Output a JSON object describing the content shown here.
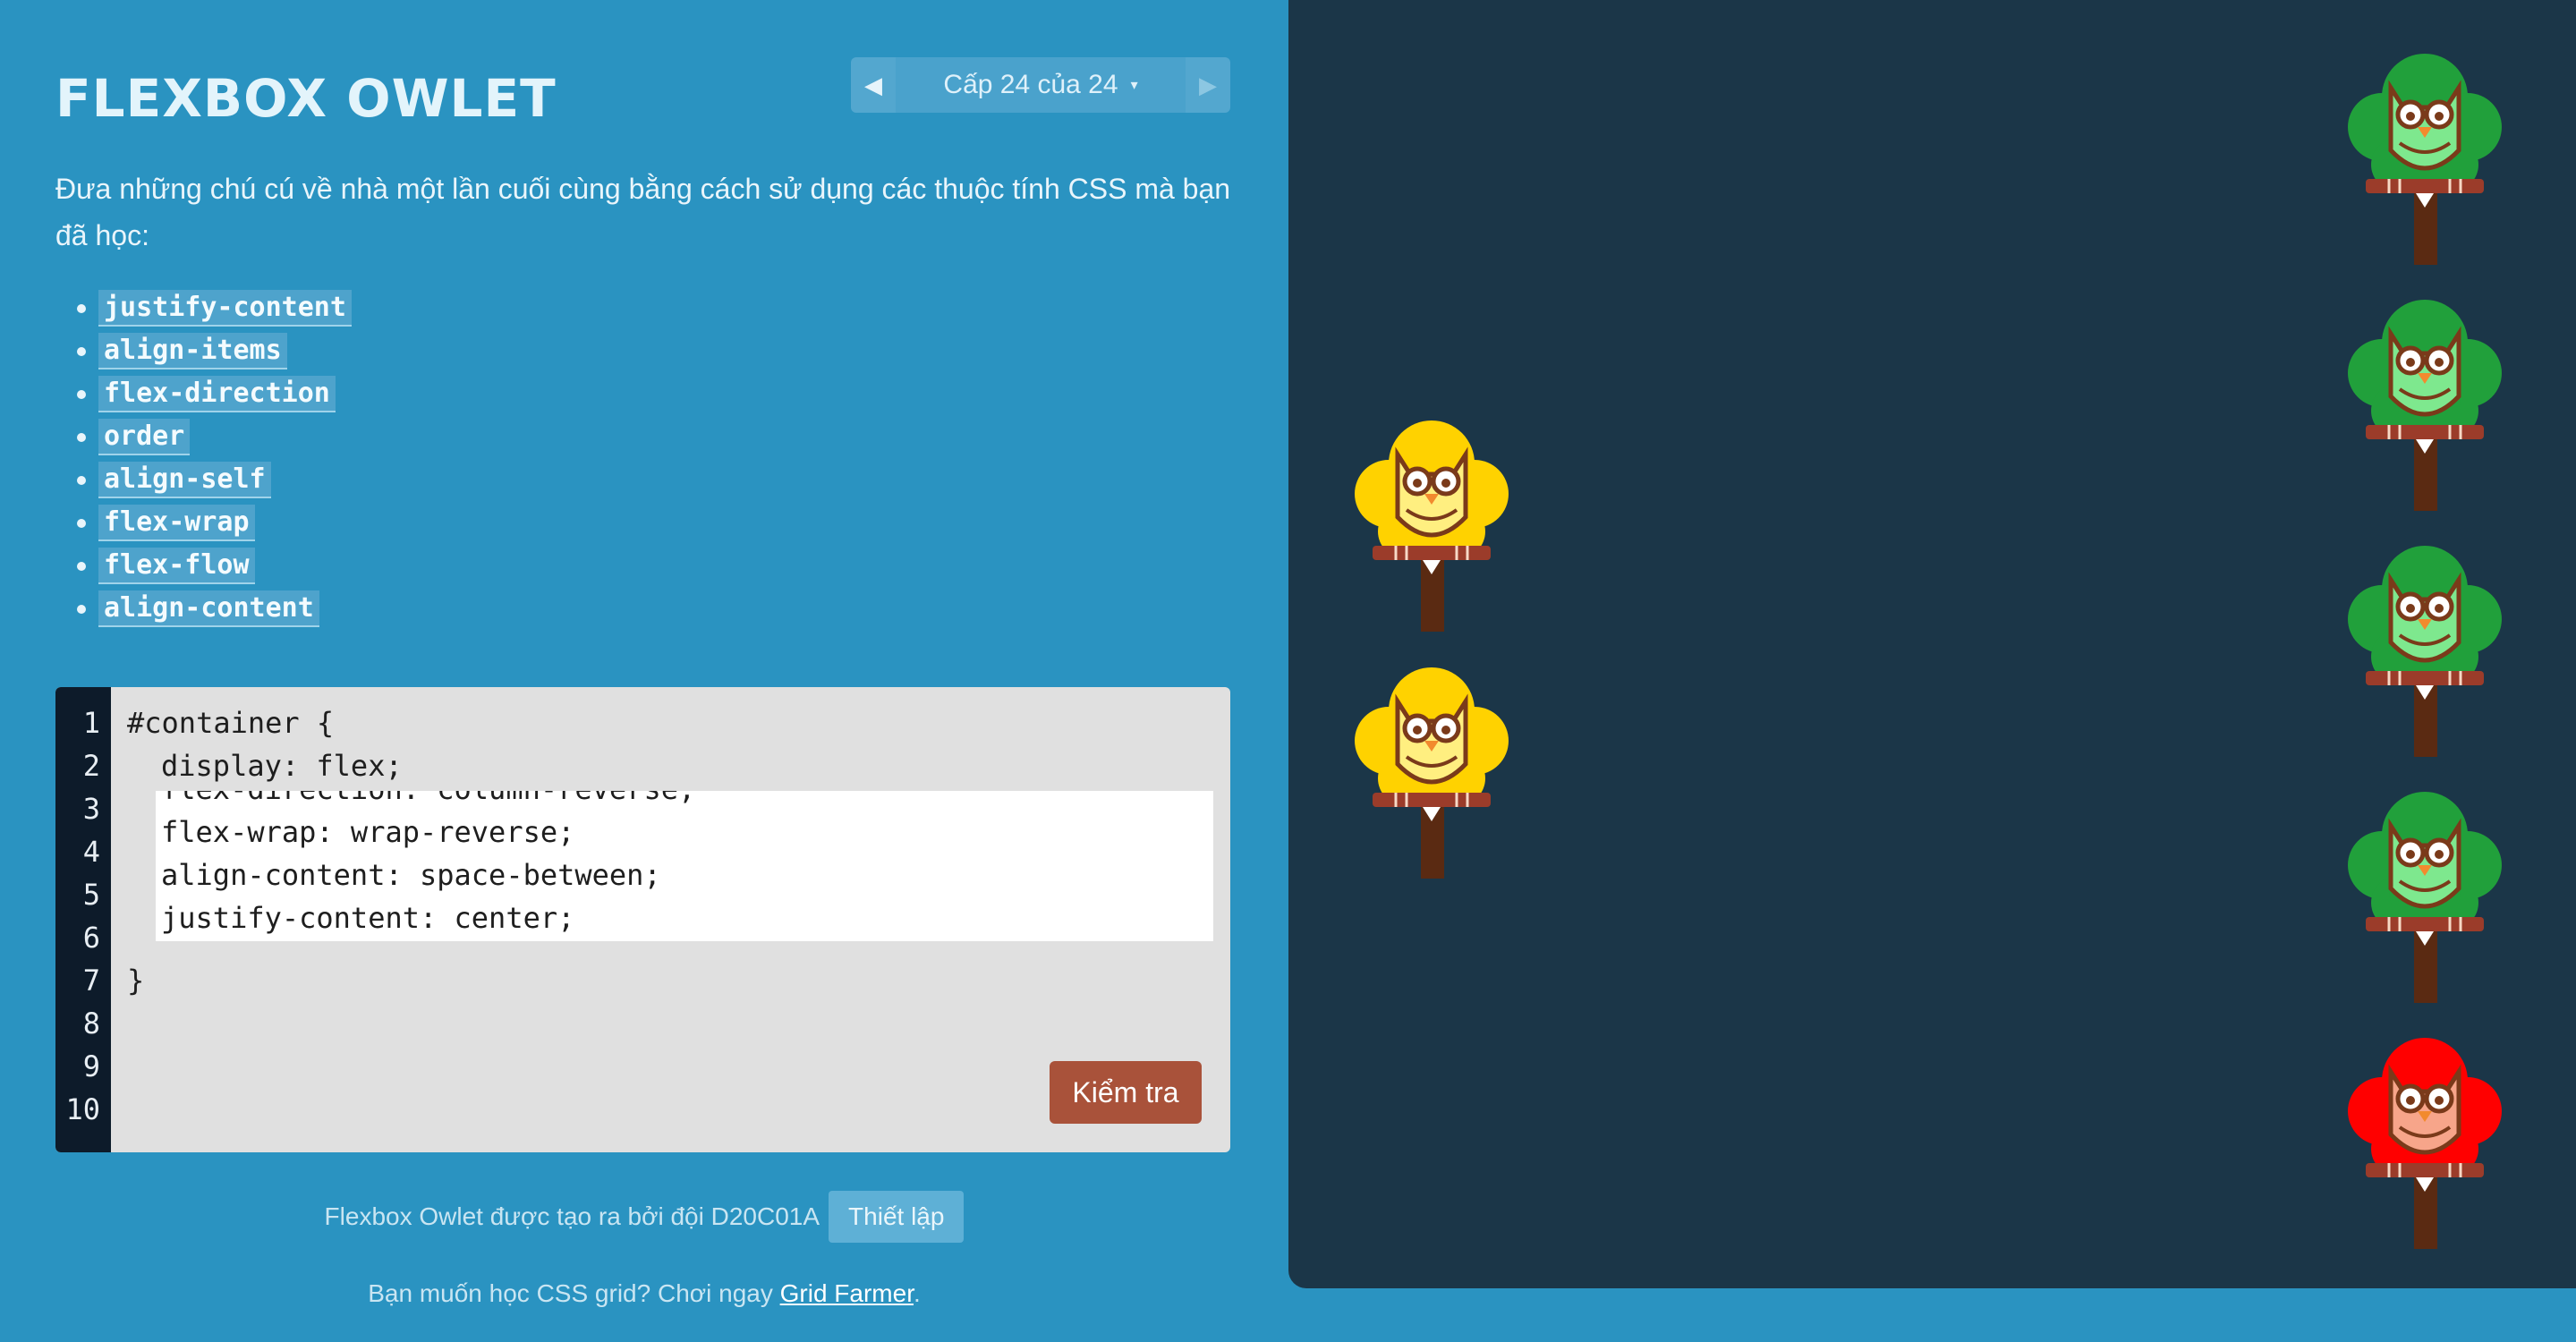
{
  "header": {
    "title": "FLEXBOX OWLET"
  },
  "level_nav": {
    "prev_icon": "triangle-left",
    "next_icon": "triangle-right",
    "label": "Cấp 24 của 24",
    "caret": "▾"
  },
  "instructions": "Đưa những chú cú về nhà một lần cuối cùng bằng cách sử dụng các thuộc tính CSS mà bạn đã học:",
  "properties": [
    "justify-content",
    "align-items",
    "flex-direction",
    "order",
    "align-self",
    "flex-wrap",
    "flex-flow",
    "align-content"
  ],
  "editor": {
    "line_numbers": [
      "1",
      "2",
      "3",
      "4",
      "5",
      "6",
      "7",
      "8",
      "9",
      "10"
    ],
    "line1": "#container {",
    "line2": "display: flex;",
    "input_lines": [
      "flex-direction: column-reverse;",
      "flex-wrap: wrap-reverse;",
      "align-content: space-between;",
      "justify-content: center;"
    ],
    "closing": "}",
    "check_label": "Kiểm tra"
  },
  "footer": {
    "credits": "Flexbox Owlet được tạo ra bởi đội D20C01A",
    "settings_label": "Thiết lập",
    "promo_prefix": "Bạn muốn học CSS grid? Chơi ngay ",
    "promo_link": "Grid Farmer",
    "promo_suffix": "."
  },
  "board": {
    "owls": [
      {
        "color": "yellow",
        "crown": "#ffd200",
        "body": "#ffef80"
      },
      {
        "color": "yellow",
        "crown": "#ffd200",
        "body": "#ffef80"
      }
    ],
    "trees": [
      {
        "color": "green",
        "crown": "#21a03b",
        "body": "#7ee88e"
      },
      {
        "color": "green",
        "crown": "#21a03b",
        "body": "#7ee88e"
      },
      {
        "color": "green",
        "crown": "#21a03b",
        "body": "#7ee88e"
      },
      {
        "color": "green",
        "crown": "#21a03b",
        "body": "#7ee88e"
      },
      {
        "color": "red",
        "crown": "#ff0000",
        "body": "#f7a58a"
      }
    ]
  },
  "colors": {
    "background": "#2a93c1",
    "board": "#1b3648",
    "check_button": "#a9523a"
  }
}
